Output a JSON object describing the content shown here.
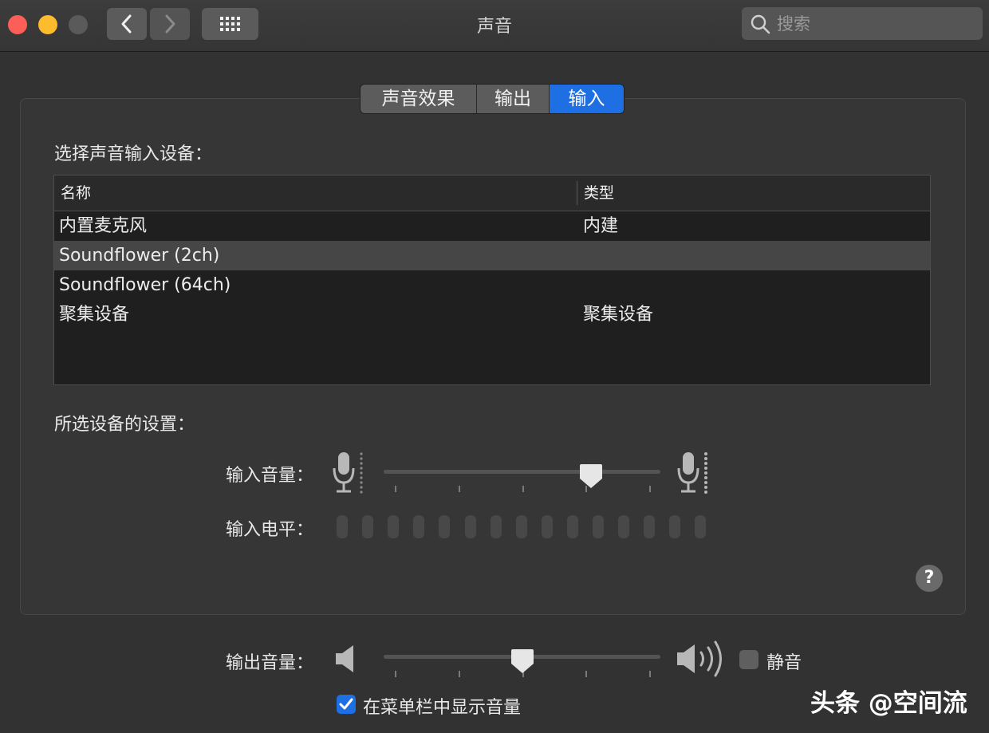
{
  "window": {
    "title": "声音"
  },
  "search": {
    "placeholder": "搜索"
  },
  "tabs": [
    {
      "label": "声音效果",
      "active": false
    },
    {
      "label": "输出",
      "active": false
    },
    {
      "label": "输入",
      "active": true
    }
  ],
  "input": {
    "select_label": "选择声音输入设备：",
    "columns": [
      "名称",
      "类型"
    ],
    "devices": [
      {
        "name": "内置麦克风",
        "type": "内建",
        "selected": false
      },
      {
        "name": "Soundflower (2ch)",
        "type": "",
        "selected": true
      },
      {
        "name": "Soundflower (64ch)",
        "type": "",
        "selected": false
      },
      {
        "name": "聚集设备",
        "type": "聚集设备",
        "selected": false
      }
    ],
    "settings_label": "所选设备的设置：",
    "volume_label": "输入音量：",
    "volume_level": 0.75,
    "level_label": "输入电平：",
    "level_segments": 15,
    "level_active": 0
  },
  "output": {
    "volume_label": "输出音量：",
    "volume_level": 0.5,
    "mute_label": "静音",
    "mute_checked": false,
    "show_in_menubar_label": "在菜单栏中显示音量",
    "show_in_menubar_checked": true
  },
  "watermark": "头条 @空间流",
  "colors": {
    "accent": "#1e6fe4",
    "background": "#323232"
  }
}
